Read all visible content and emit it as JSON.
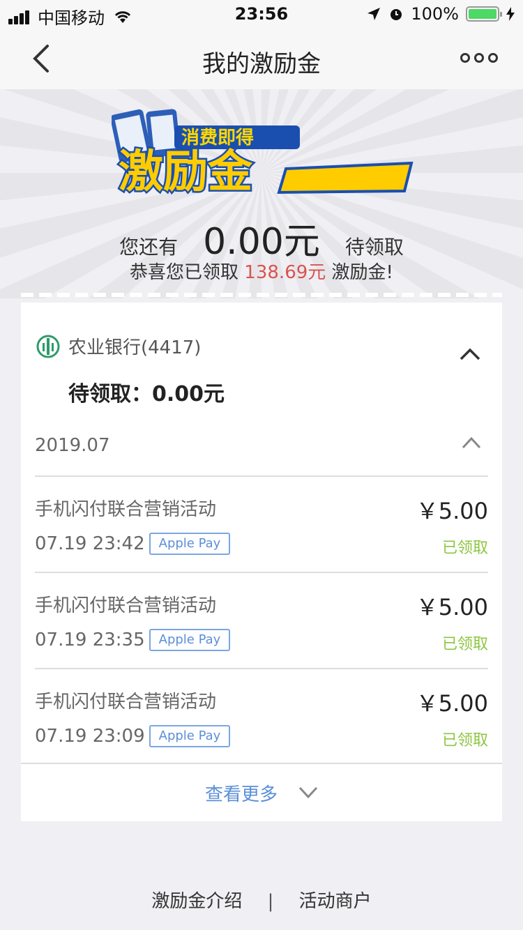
{
  "status_bar": {
    "carrier": "中国移动",
    "time": "23:56",
    "battery": "100%"
  },
  "nav": {
    "title": "我的激励金"
  },
  "summary": {
    "prefix": "您还有",
    "amount": "0.00元",
    "suffix": "待领取",
    "received_prefix": "恭喜您已领取",
    "received_amount": "138.69元",
    "received_suffix": "激励金!"
  },
  "banner": {
    "tagline": "消费即得",
    "title": "激励金"
  },
  "card": {
    "bank_name": "农业银行(4417)",
    "pending_label": "待领取：0.00元",
    "month": "2019.07",
    "transactions": [
      {
        "title": "手机闪付联合营销活动",
        "time": "07.19 23:42",
        "method": "Apple Pay",
        "amount": "￥5.00",
        "status": "已领取"
      },
      {
        "title": "手机闪付联合营销活动",
        "time": "07.19 23:35",
        "method": "Apple Pay",
        "amount": "￥5.00",
        "status": "已领取"
      },
      {
        "title": "手机闪付联合营销活动",
        "time": "07.19 23:09",
        "method": "Apple Pay",
        "amount": "￥5.00",
        "status": "已领取"
      }
    ],
    "more_label": "查看更多"
  },
  "footer": {
    "intro": "激励金介绍",
    "separator": "|",
    "merchants": "活动商户"
  },
  "colors": {
    "accent_blue": "#5b8fd9",
    "received_red": "#d9534f",
    "status_green": "#8cc63f",
    "bank_green": "#2e9a6a"
  }
}
